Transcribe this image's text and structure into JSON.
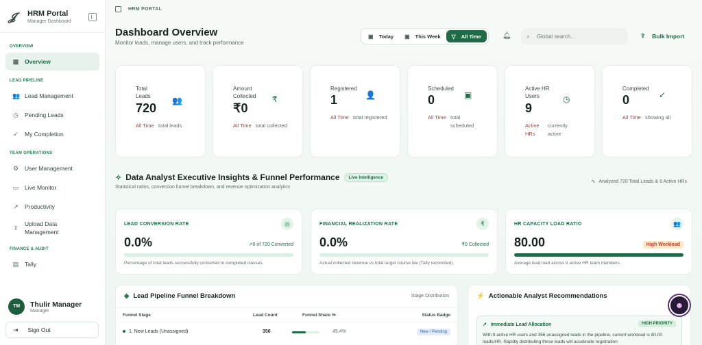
{
  "brand": {
    "title": "HRM Portal",
    "subtitle": "Manager Dashboard"
  },
  "sidebar": {
    "sections": [
      {
        "title": "OVERVIEW"
      },
      {
        "title": "LEAD PIPELINE"
      },
      {
        "title": "TEAM OPERATIONS"
      },
      {
        "title": "FINANCE & AUDIT"
      }
    ],
    "items": [
      {
        "label": "Overview",
        "icon": "grid-icon"
      },
      {
        "label": "Lead Management",
        "icon": "users-icon"
      },
      {
        "label": "Pending Leads",
        "icon": "clock-icon"
      },
      {
        "label": "My Completion",
        "icon": "check-circle-icon"
      },
      {
        "label": "User Management",
        "icon": "user-cog-icon"
      },
      {
        "label": "Live Monitor",
        "icon": "video-icon"
      },
      {
        "label": "Productivity",
        "icon": "trending-up-icon"
      },
      {
        "label": "Upload Data Management",
        "icon": "upload-icon"
      },
      {
        "label": "Tally",
        "icon": "book-icon"
      }
    ]
  },
  "user": {
    "initials": "TM",
    "name": "Thulir Manager",
    "role": "Manager"
  },
  "signout_label": "Sign Out",
  "header": {
    "breadcrumb": "HRM PORTAL",
    "title": "Dashboard Overview",
    "subtitle": "Monitor leads, manage users, and track performance",
    "filters": [
      "Today",
      "This Week",
      "All Time"
    ],
    "search_placeholder": "Global search...",
    "bulk_import": "Bulk Import"
  },
  "stats": [
    {
      "label": "Total Leads",
      "value": "720",
      "period": "All Time",
      "note": "total leads"
    },
    {
      "label": "Amount Collected",
      "value": "₹0",
      "period": "All Time",
      "note": "total collected"
    },
    {
      "label": "Registered",
      "value": "1",
      "period": "All Time",
      "note": "total registered"
    },
    {
      "label": "Scheduled",
      "value": "0",
      "period": "All Time",
      "note": "total scheduled"
    },
    {
      "label": "Active HR Users",
      "value": "9",
      "period": "Active HRs",
      "note": "currently active"
    },
    {
      "label": "Completed",
      "value": "0",
      "period": "All Time",
      "note": "showing all"
    }
  ],
  "insights": {
    "title": "Data Analyst Executive Insights & Funnel Performance",
    "badge": "Live Intelligence",
    "subtitle": "Statistical ratios, conversion funnel breakdown, and revenue optimization analytics",
    "analyzed": "Analyzed 720 Total Leads & 9 Active HRs"
  },
  "kpis": [
    {
      "title": "LEAD CONVERSION RATE",
      "value": "0.0%",
      "note": "↗0 of 720 Converted",
      "progress": 0,
      "desc": "Percentage of total leads successfully converted to completed classes."
    },
    {
      "title": "FINANCIAL REALIZATION RATE",
      "value": "0.0%",
      "note": "₹0 Collected",
      "progress": 0,
      "desc": "Actual collected revenue vs total target course fee (Tally reconciled)."
    },
    {
      "title": "HR CAPACITY LOAD RATIO",
      "value": "80.00",
      "note": "High Workload",
      "progress": 1,
      "desc": "Average lead load across 9 active HR team members."
    }
  ],
  "funnel": {
    "title": "Lead Pipeline Funnel Breakdown",
    "side": "Stage Distribution",
    "columns": [
      "Funnel Stage",
      "Lead Count",
      "Funnel Share %",
      "Status Badge"
    ],
    "rows": [
      {
        "stage": "1. New Leads (Unassigned)",
        "count": "356",
        "share": "49.4%",
        "share_value": 0.494,
        "status": "New / Pending"
      }
    ]
  },
  "recommendations": {
    "title": "Actionable Analyst Recommendations",
    "cards": [
      {
        "title": "Immediate Lead Allocation",
        "priority": "HIGH PRIORITY",
        "body": "With 9 active HR users and 356 unassigned leads in the pipeline, current workload is 80.00 leads/HR. Rapidly distributing these leads will accelerate registration"
      }
    ]
  },
  "colors": {
    "accent": "#1f6b45",
    "accent_light": "#e6f2eb",
    "warning": "#c0392b"
  }
}
